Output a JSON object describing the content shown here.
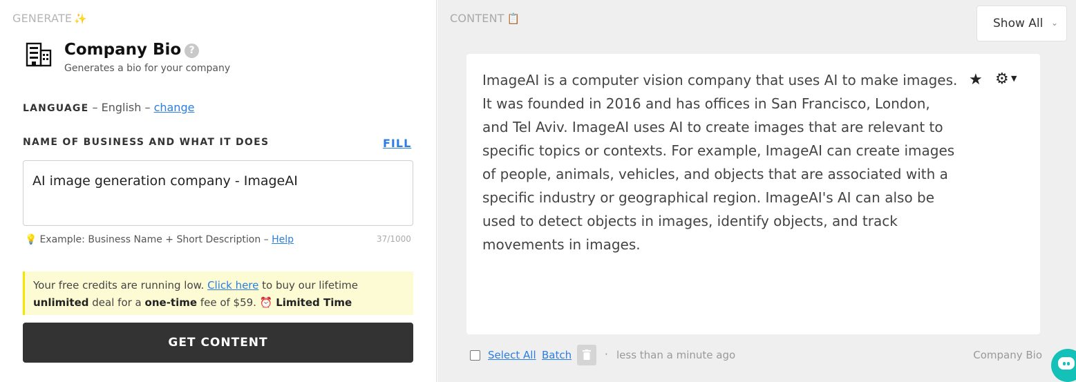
{
  "left": {
    "section_title": "GENERATE",
    "section_emoji": "✨",
    "tool_title": "Company Bio",
    "tool_help": "?",
    "tool_subtitle": "Generates a bio for your company",
    "language_label": "LANGUAGE",
    "language_sep": "–",
    "language_value": "English",
    "language_sep2": "–",
    "language_change": "change",
    "field_label": "NAME OF BUSINESS AND WHAT IT DOES",
    "fill_label": "FILL",
    "field_value": "AI image generation company - ImageAI",
    "hint_icon": "💡",
    "hint_text": "Example: Business Name + Short Description –",
    "hint_help": "Help",
    "counter": "37/1000",
    "notice": {
      "part1": "Your free credits are running low.",
      "link": "Click here",
      "part2": "to buy our lifetime",
      "bold1": "unlimited",
      "part3": "deal for a",
      "bold2": "one-time",
      "part4": "fee of $59.",
      "alarm": "⏰",
      "bold3": "Limited Time"
    },
    "get_button": "GET CONTENT"
  },
  "right": {
    "section_title": "CONTENT",
    "section_emoji": "📋",
    "filter_value": "Show All",
    "filter_chevron": "⌄",
    "output_text": "ImageAI is a computer vision company that uses AI to make images. It was founded in 2016 and has offices in San Francisco, London, and Tel Aviv. ImageAI uses AI to create images that are relevant to specific topics or contexts. For example, ImageAI can create images of people, animals, vehicles, and objects that are associated with a specific industry or geographical region. ImageAI's AI can also be used to detect objects in images, identify objects, and track movements in images.",
    "star_icon": "★",
    "gear_icon": "⚙",
    "gear_caret": "▼",
    "footer": {
      "select_all": "Select All",
      "batch": "Batch",
      "dot": "·",
      "time": "less than a minute ago",
      "type": "Company Bio"
    }
  },
  "colors": {
    "accent_link": "#2a7de1",
    "button_dark": "#333333",
    "notice_bg": "#fdfbd3",
    "chat_button": "#14c1b8"
  },
  "icons": {
    "tool": "building-icon",
    "help": "question-circle-icon",
    "trash": "trash-icon",
    "chat": "chat-icon"
  }
}
